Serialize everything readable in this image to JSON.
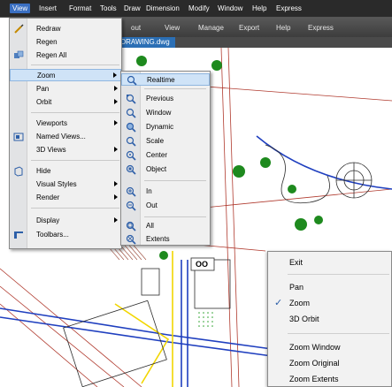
{
  "menubar": {
    "items": [
      {
        "label": "View",
        "active": true
      },
      {
        "label": "Insert"
      },
      {
        "label": "Format"
      },
      {
        "label": "Tools"
      },
      {
        "label": "Draw"
      },
      {
        "label": "Dimension"
      },
      {
        "label": "Modify"
      },
      {
        "label": "Window"
      },
      {
        "label": "Help"
      },
      {
        "label": "Express"
      }
    ]
  },
  "ribbon": {
    "tabs": [
      "out",
      "View",
      "Manage",
      "Export",
      "Help",
      "Express"
    ]
  },
  "document_tab": {
    "label": "L DRAWING.dwg"
  },
  "view_menu": {
    "items": [
      {
        "label": "Redraw",
        "icon": "redraw-icon"
      },
      {
        "label": "Regen"
      },
      {
        "label": "Regen All",
        "icon": "regen-all-icon"
      },
      {
        "label": "Zoom",
        "submenu": true,
        "highlighted": true
      },
      {
        "label": "Pan",
        "submenu": true
      },
      {
        "label": "Orbit",
        "submenu": true
      },
      {
        "label": "Viewports",
        "submenu": true
      },
      {
        "label": "Named Views...",
        "icon": "named-views-icon"
      },
      {
        "label": "3D Views",
        "submenu": true
      },
      {
        "label": "Hide",
        "icon": "hide-icon"
      },
      {
        "label": "Visual Styles",
        "submenu": true
      },
      {
        "label": "Render",
        "submenu": true
      },
      {
        "label": "Display",
        "submenu": true
      },
      {
        "label": "Toolbars...",
        "icon": "toolbars-icon"
      }
    ]
  },
  "zoom_submenu": {
    "items": [
      {
        "label": "Realtime",
        "icon": "zoom-realtime-icon",
        "highlighted": true
      },
      {
        "label": "Previous",
        "icon": "zoom-previous-icon"
      },
      {
        "label": "Window",
        "icon": "zoom-window-icon"
      },
      {
        "label": "Dynamic",
        "icon": "zoom-dynamic-icon"
      },
      {
        "label": "Scale",
        "icon": "zoom-scale-icon"
      },
      {
        "label": "Center",
        "icon": "zoom-center-icon"
      },
      {
        "label": "Object",
        "icon": "zoom-object-icon"
      },
      {
        "label": "In",
        "icon": "zoom-in-icon"
      },
      {
        "label": "Out",
        "icon": "zoom-out-icon"
      },
      {
        "label": "All",
        "icon": "zoom-all-icon"
      },
      {
        "label": "Extents",
        "icon": "zoom-extents-icon"
      }
    ]
  },
  "context_menu": {
    "items": [
      {
        "label": "Exit"
      },
      {
        "label": "Pan"
      },
      {
        "label": "Zoom",
        "checked": true
      },
      {
        "label": "3D Orbit"
      },
      {
        "label": "Zoom Window"
      },
      {
        "label": "Zoom Original"
      },
      {
        "label": "Zoom Extents"
      }
    ],
    "check_glyph": "✓"
  },
  "drawing": {
    "labels": [
      "OO"
    ]
  },
  "colors": {
    "menubar_bg": "#2a2a2a",
    "menu_highlight": "#cfe3f7",
    "doc_tab": "#2b6fb5",
    "road_blue": "#1f3fbf",
    "accent_yellow": "#f2d600",
    "tree_green": "#1e8a1e"
  }
}
